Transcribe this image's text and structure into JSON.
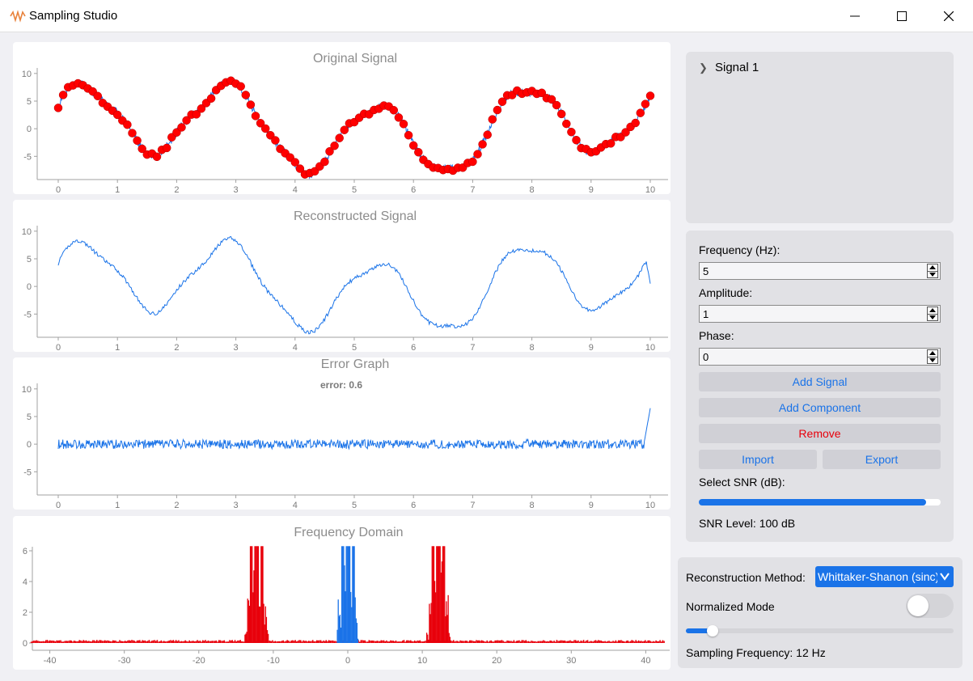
{
  "window": {
    "title": "Sampling Studio",
    "app_icon": "waveform-icon"
  },
  "plots": {
    "original": {
      "title": "Original Signal",
      "yticks": [
        "10",
        "5",
        "0",
        "-5"
      ],
      "xticks": [
        "0",
        "1",
        "2",
        "3",
        "4",
        "5",
        "6",
        "7",
        "8",
        "9",
        "10"
      ]
    },
    "reconstructed": {
      "title": "Reconstructed Signal",
      "yticks": [
        "10",
        "5",
        "0",
        "-5"
      ],
      "xticks": [
        "0",
        "1",
        "2",
        "3",
        "4",
        "5",
        "6",
        "7",
        "8",
        "9",
        "10"
      ]
    },
    "error": {
      "title": "Error Graph",
      "annotation": "error: 0.6",
      "yticks": [
        "10",
        "5",
        "0",
        "-5"
      ],
      "xticks": [
        "0",
        "1",
        "2",
        "3",
        "4",
        "5",
        "6",
        "7",
        "8",
        "9",
        "10"
      ]
    },
    "frequency": {
      "title": "Frequency Domain",
      "yticks": [
        "6",
        "4",
        "2",
        "0"
      ],
      "xticks": [
        "-40",
        "-30",
        "-20",
        "-10",
        "0",
        "10",
        "20",
        "30",
        "40"
      ]
    }
  },
  "chart_data": [
    {
      "type": "line",
      "title": "Original Signal",
      "xlim": [
        0,
        10
      ],
      "ylim": [
        -9,
        11
      ],
      "series": [
        {
          "style": "line",
          "color": "#1a73e8"
        },
        {
          "style": "scatter",
          "color": "#ff0000",
          "sampling_frequency_hz": 12
        }
      ],
      "grid": false
    },
    {
      "type": "line",
      "title": "Reconstructed Signal",
      "xlim": [
        0,
        10
      ],
      "ylim": [
        -9,
        11
      ],
      "series": [
        {
          "style": "line",
          "color": "#1a73e8"
        }
      ],
      "grid": false
    },
    {
      "type": "line",
      "title": "Error Graph",
      "annotation": "error: 0.6",
      "xlim": [
        0,
        10
      ],
      "ylim": [
        -9,
        11
      ],
      "series": [
        {
          "style": "line",
          "color": "#1a73e8",
          "mean": 0,
          "approx_amplitude": 1.2,
          "end_spike": 6.5
        }
      ],
      "grid": false
    },
    {
      "type": "bar",
      "title": "Frequency Domain",
      "xlim": [
        -43,
        43
      ],
      "ylim": [
        -0.2,
        6.5
      ],
      "series": [
        {
          "color": "#1a73e8",
          "peaks_at_x": [
            -1,
            0,
            1
          ],
          "peak_value": 6
        },
        {
          "color": "#e8000b",
          "peaks_at_x": [
            -12.5,
            12
          ],
          "peak_value": 6
        }
      ],
      "grid": false
    }
  ],
  "signals_tree": {
    "items": [
      "Signal 1"
    ],
    "expand_icon": "chevron-right-icon"
  },
  "controls": {
    "frequency_label": "Frequency (Hz):",
    "frequency_value": "5",
    "amplitude_label": "Amplitude:",
    "amplitude_value": "1",
    "phase_label": "Phase:",
    "phase_value": "0",
    "add_signal": "Add Signal",
    "add_component": "Add Component",
    "remove": "Remove",
    "import": "Import",
    "export": "Export",
    "snr_label": "Select SNR (dB):",
    "snr_fraction": 0.94,
    "snr_level": "SNR Level: 100 dB"
  },
  "reconstruction": {
    "method_label": "Reconstruction Method:",
    "method_value": "Whittaker-Shanon (sinc)",
    "normalized_label": "Normalized Mode",
    "normalized_on": false,
    "sampling_fraction": 0.1,
    "sampling_text": "Sampling Frequency: 12 Hz"
  },
  "colors": {
    "accent": "#1a73e8",
    "sample_red": "#ff0000",
    "remove_red": "#e8000b"
  }
}
